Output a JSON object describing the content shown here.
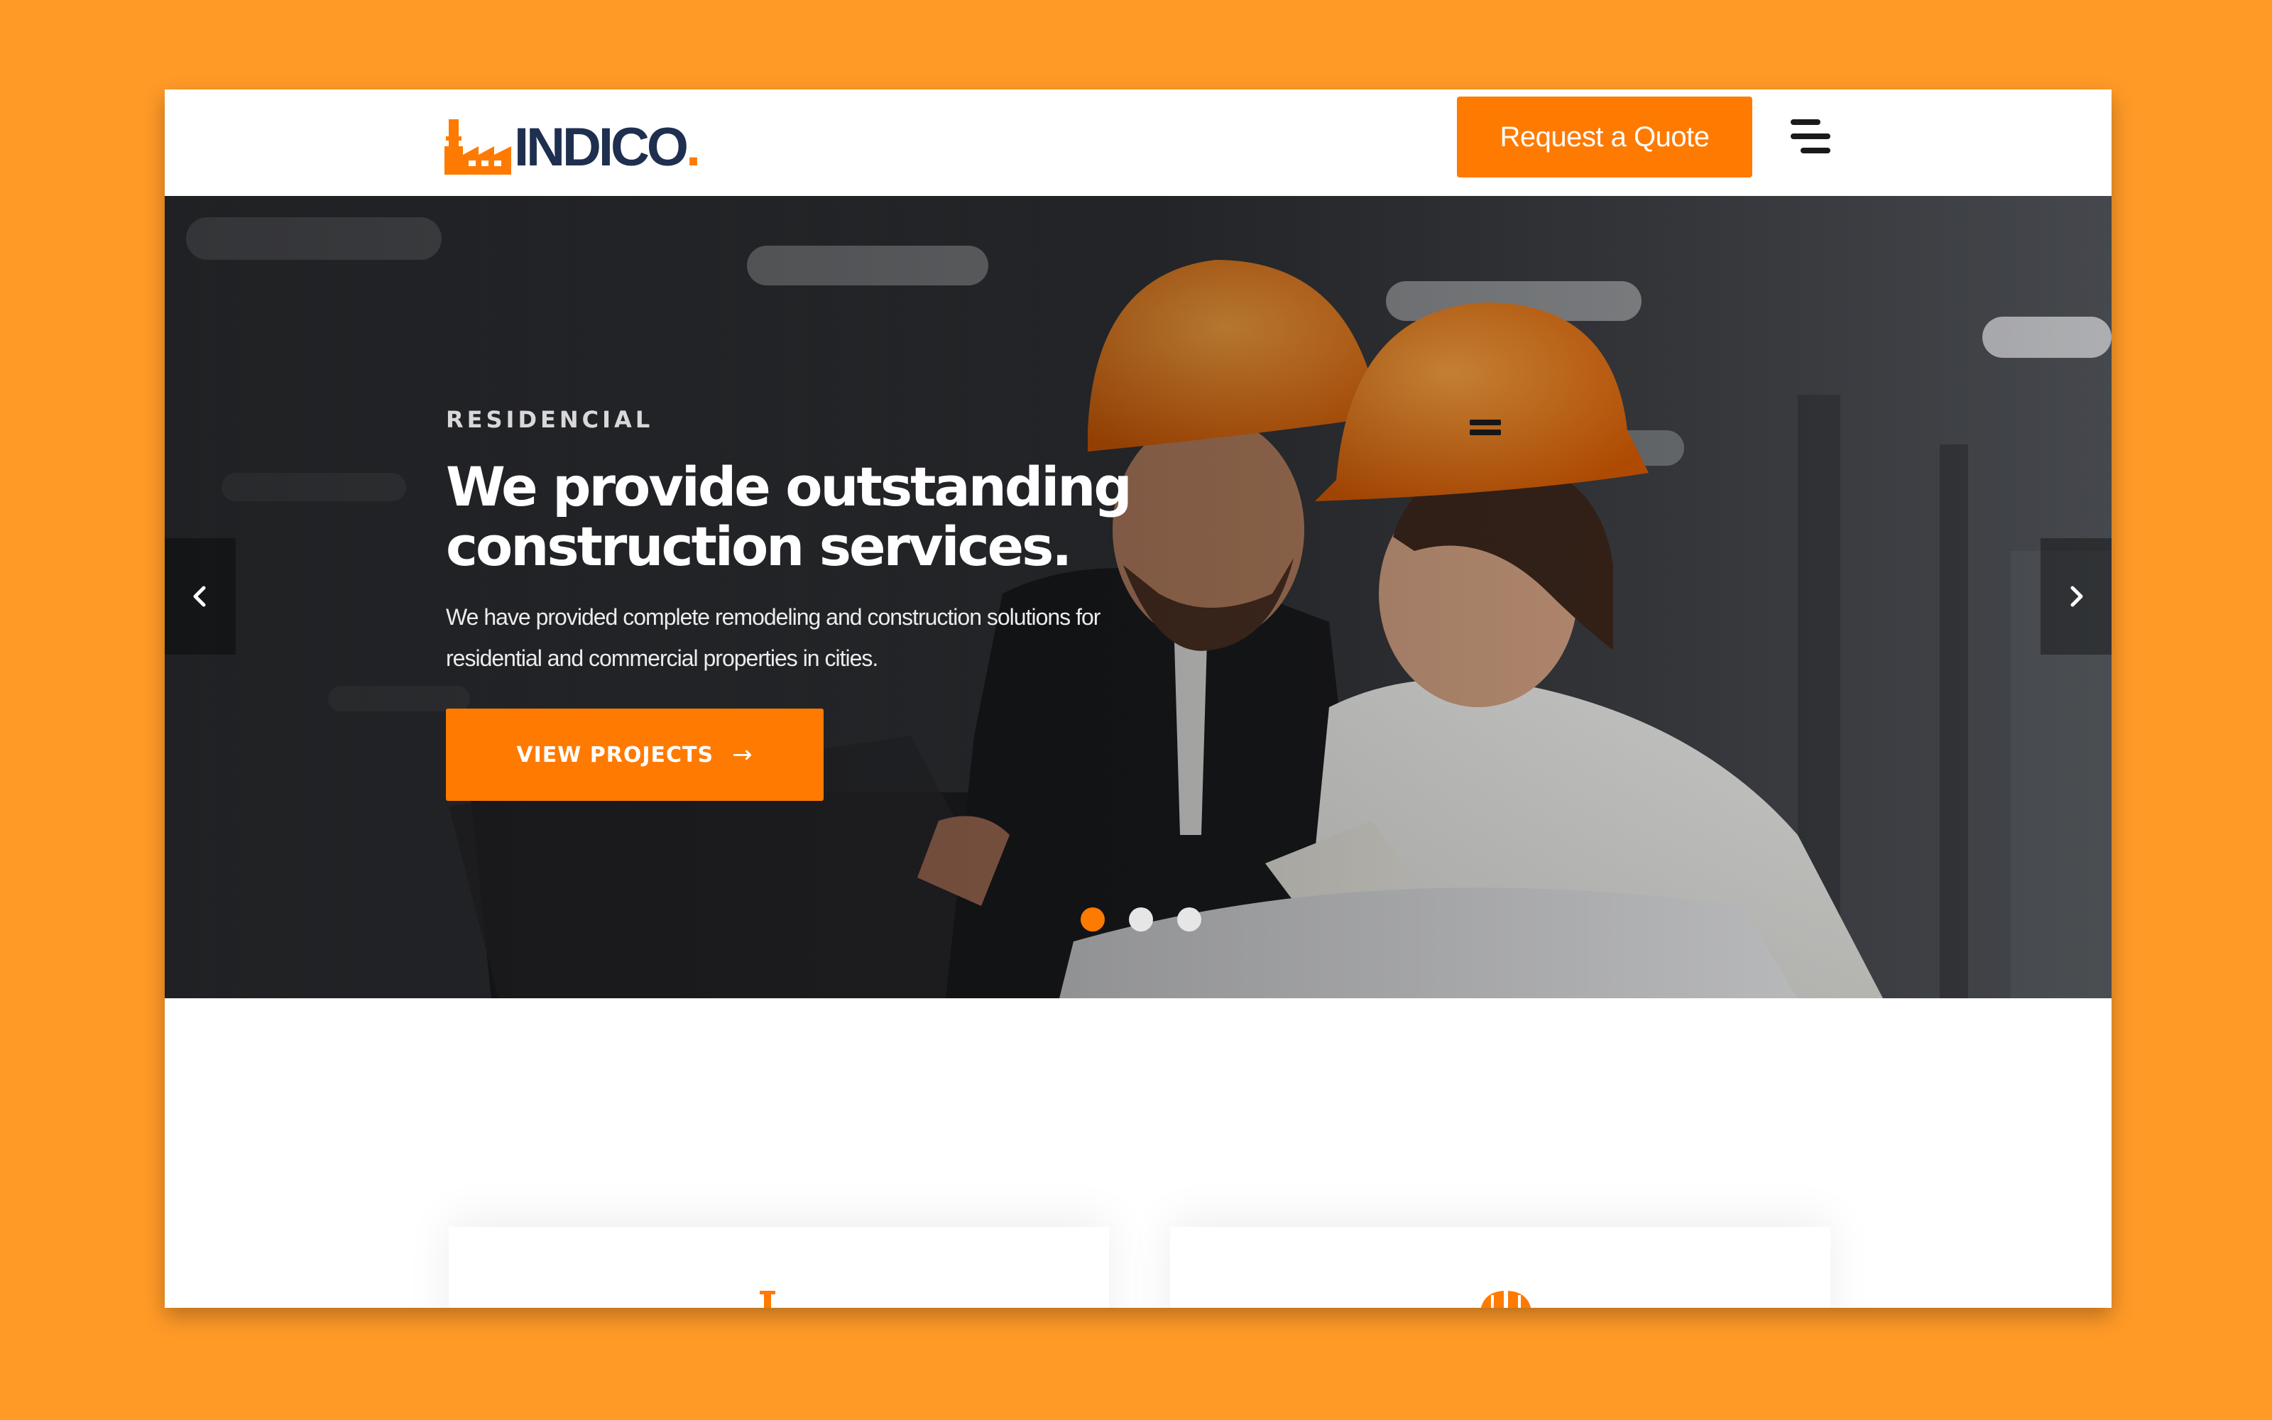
{
  "brand": {
    "name": "INDICO",
    "dot": ".",
    "logo_icon": "factory-icon",
    "accent_color": "#ff7a00",
    "text_color": "#1f2f4f"
  },
  "header": {
    "quote_label": "Request a Quote",
    "menu_icon": "menu-icon"
  },
  "hero": {
    "eyebrow": "RESIDENCIAL",
    "headline_line1": "We provide outstanding",
    "headline_line2": "construction services.",
    "subtext_line1": "We have provided complete remodeling and construction solutions for",
    "subtext_line2": "residential and commercial properties in cities.",
    "cta_label": "VIEW PROJECTS",
    "cta_icon": "arrow-right-icon",
    "prev_icon": "chevron-left-icon",
    "next_icon": "chevron-right-icon",
    "slides": 3,
    "active_slide": 1
  },
  "features": {
    "cards": [
      {
        "icon": "crane-icon"
      },
      {
        "icon": "hard-hat-icon"
      }
    ]
  }
}
